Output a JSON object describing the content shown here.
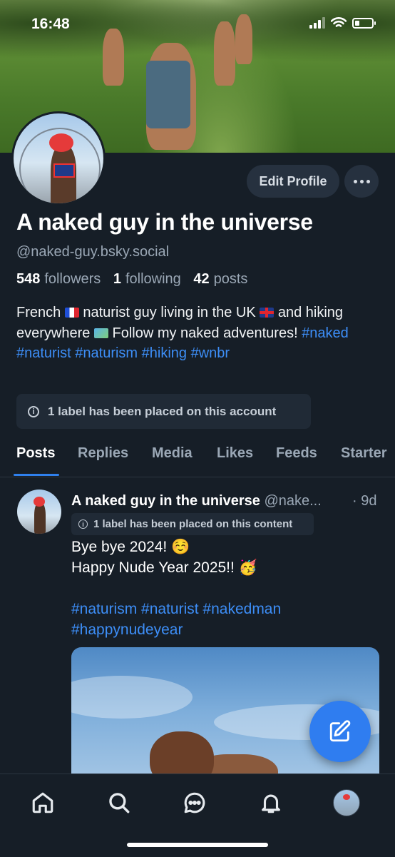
{
  "status_bar": {
    "time": "16:48",
    "battery_level": 0.25
  },
  "profile": {
    "display_name": "A naked guy in the universe",
    "handle": "@naked-guy.bsky.social",
    "followers_count": "548",
    "followers_label": "followers",
    "following_count": "1",
    "following_label": "following",
    "posts_count": "42",
    "posts_label": "posts",
    "edit_profile_label": "Edit Profile",
    "bio": {
      "part1": "French ",
      "part2": " naturist guy living in the UK ",
      "part3": " and hiking everywhere ",
      "part4": " Follow my naked adventures! ",
      "hashtags": [
        "#naked",
        "#naturist",
        "#naturism",
        "#hiking",
        "#wnbr"
      ]
    },
    "account_label_text": "1 label has been placed on this account"
  },
  "tabs": [
    {
      "label": "Posts",
      "active": true
    },
    {
      "label": "Replies",
      "active": false
    },
    {
      "label": "Media",
      "active": false
    },
    {
      "label": "Likes",
      "active": false
    },
    {
      "label": "Feeds",
      "active": false
    },
    {
      "label": "Starter",
      "active": false
    }
  ],
  "post": {
    "author_name": "A naked guy in the universe",
    "author_handle": "@nake...",
    "time": "· 9d",
    "content_label_text": "1 label has been placed on this content",
    "line1": "Bye bye 2024! ☺️",
    "line2": "Happy Nude Year 2025!! 🥳",
    "hashtags_line1": "#naturism #naturist #nakedman",
    "hashtags_line2": "#happynudeyear"
  },
  "icons": {
    "nav": [
      "home-icon",
      "search-icon",
      "chat-icon",
      "bell-icon",
      "profile-avatar"
    ],
    "fab": "compose-icon"
  },
  "colors": {
    "accent": "#2f7df0",
    "link": "#3d8ef7",
    "background": "#161e27"
  }
}
